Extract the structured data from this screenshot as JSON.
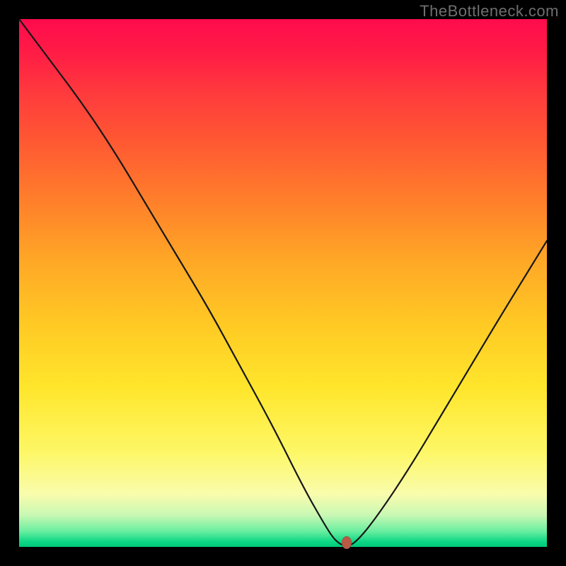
{
  "watermark": "TheBottleneck.com",
  "chart_data": {
    "type": "line",
    "title": "",
    "xlabel": "",
    "ylabel": "",
    "xlim": [
      0,
      100
    ],
    "ylim": [
      0,
      100
    ],
    "series": [
      {
        "name": "bottleneck-curve",
        "x": [
          0,
          6,
          12,
          18,
          24,
          30,
          36,
          42,
          48,
          54,
          58,
          60,
          62,
          64,
          68,
          74,
          80,
          86,
          92,
          100
        ],
        "y": [
          100,
          92,
          84,
          75,
          65,
          55,
          45,
          34,
          23,
          11,
          4,
          1,
          0,
          1,
          6,
          15,
          25,
          35,
          45,
          58
        ]
      }
    ],
    "marker": {
      "x": 62,
      "y": 0.8,
      "color": "#b85a46"
    },
    "gradient_stops": [
      {
        "pos": 0,
        "color": "#ff0b4d"
      },
      {
        "pos": 24,
        "color": "#ff5b32"
      },
      {
        "pos": 58,
        "color": "#ffca24"
      },
      {
        "pos": 90,
        "color": "#f9fcac"
      },
      {
        "pos": 100,
        "color": "#00c977"
      }
    ]
  }
}
